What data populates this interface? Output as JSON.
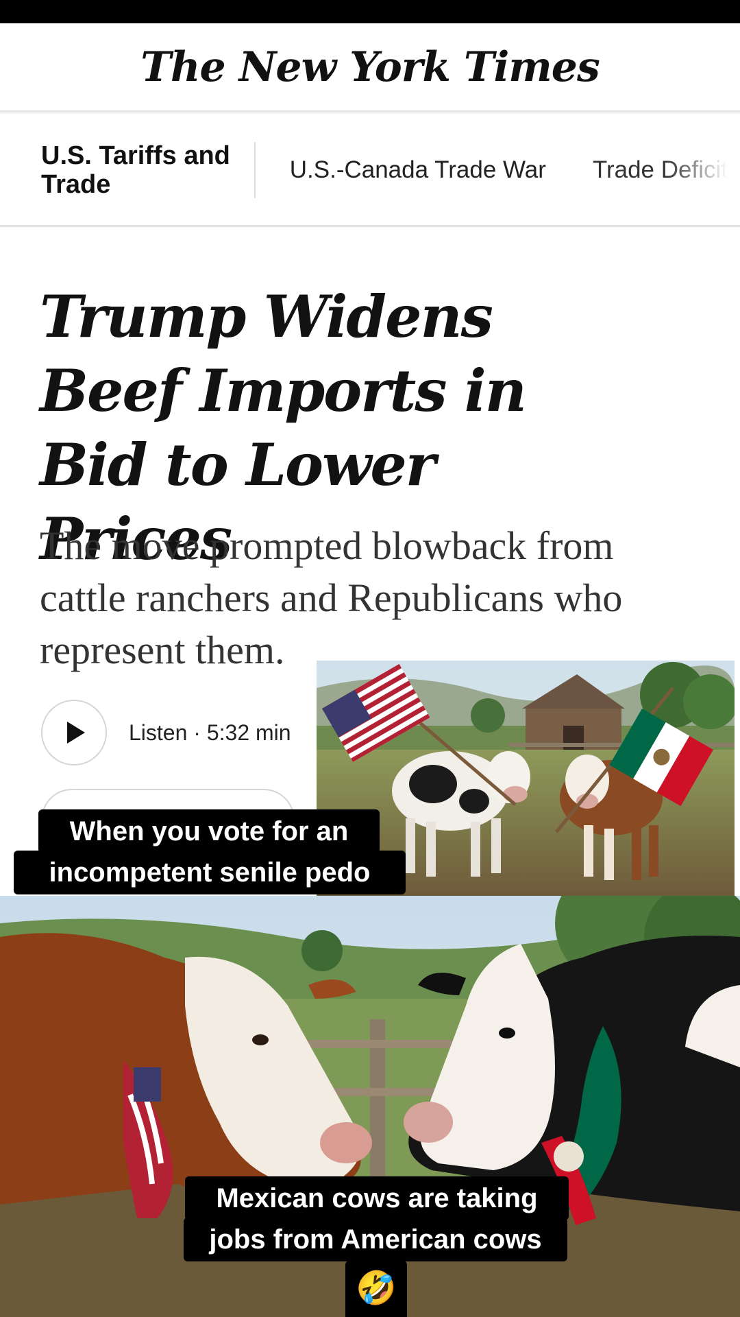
{
  "masthead": {
    "logo_text": "The New York Times"
  },
  "subnav": {
    "section_label": "U.S. Tariffs and Trade",
    "items": [
      "U.S.-Canada Trade War",
      "Trade Deficit"
    ]
  },
  "article": {
    "headline": "Trump Widens Beef Imports in Bid to Lower Prices",
    "summary": "The move prompted blowback from cattle ranchers and Republicans who represent them.",
    "listen_label": "Listen · 5:32 min"
  },
  "overlay": {
    "caption_top_line1": "When you vote for an",
    "caption_top_line2": "incompetent senile pedo",
    "caption_bottom_line1": "Mexican cows are taking",
    "caption_bottom_line2": "jobs from American cows",
    "caption_emoji": "🤣"
  },
  "images": {
    "inset": "two cows standing in a farm field, one with a United States flag, one with a Mexico flag, barn in background",
    "bottom": "close-up of two cows facing each other, brown cow wearing a US flag bandana, black-and-white cow wearing a Mexico flag bandana"
  },
  "colors": {
    "flag_red": "#b22234",
    "flag_green": "#006847",
    "text": "#121212"
  }
}
